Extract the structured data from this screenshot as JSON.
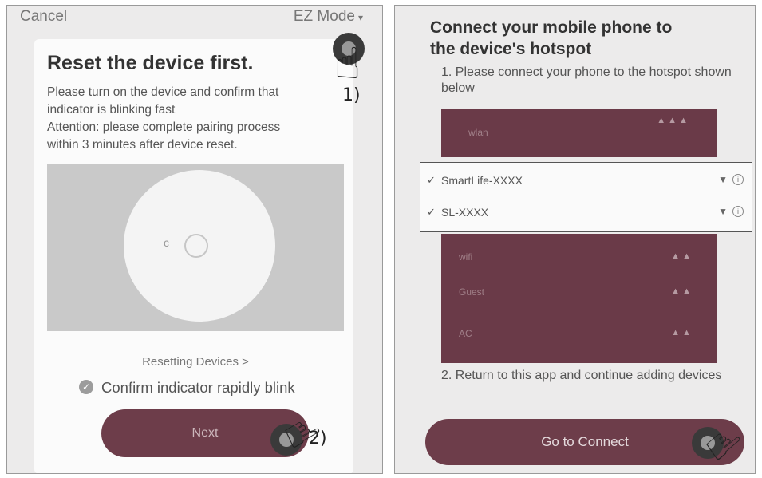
{
  "left": {
    "cancel": "Cancel",
    "ez_mode": "EZ Mode",
    "title": "Reset the device first.",
    "instructions": [
      "Please turn on the device and confirm that",
      "indicator is blinking fast",
      "Attention: please complete pairing process",
      "within 3 minutes after device reset."
    ],
    "resetting_link": "Resetting Devices >",
    "confirm_label": "Confirm indicator rapidly blink",
    "next_button": "Next",
    "callout_1": "1)",
    "callout_2": "2)"
  },
  "right": {
    "title_line1": "Connect your mobile phone to",
    "title_line2": "the device's hotspot",
    "step1": "1. Please connect your phone to the hotspot shown below",
    "networks": [
      {
        "name": "SmartLife-XXXX"
      },
      {
        "name": "SL-XXXX"
      }
    ],
    "step2": "2. Return to this app and continue adding devices",
    "connect_button": "Go to Connect"
  },
  "colors": {
    "accent": "#6d3d4a",
    "background": "#ecebeb",
    "card": "#fbfbfb"
  },
  "icons": [
    "caret-down-icon",
    "check-circle-icon",
    "tap-hand-icon",
    "wifi-signal-icon",
    "info-icon",
    "checkmark-icon"
  ]
}
